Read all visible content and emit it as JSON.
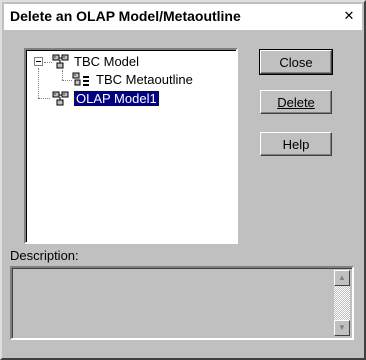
{
  "window": {
    "title": "Delete an OLAP Model/Metaoutline",
    "close_glyph": "✕"
  },
  "tree": {
    "nodes": [
      {
        "label": "TBC Model",
        "icon": "olap-model-icon",
        "level": 0,
        "expanded": true
      },
      {
        "label": "TBC Metaoutline",
        "icon": "metaoutline-icon",
        "level": 1
      },
      {
        "label": "OLAP Model1",
        "icon": "olap-model-icon",
        "level": 0,
        "selected": true
      }
    ]
  },
  "buttons": {
    "close": "Close",
    "delete": "Delete",
    "help": "Help"
  },
  "description": {
    "label": "Description:",
    "value": "",
    "scroll_up_glyph": "▲",
    "scroll_down_glyph": "▼"
  }
}
